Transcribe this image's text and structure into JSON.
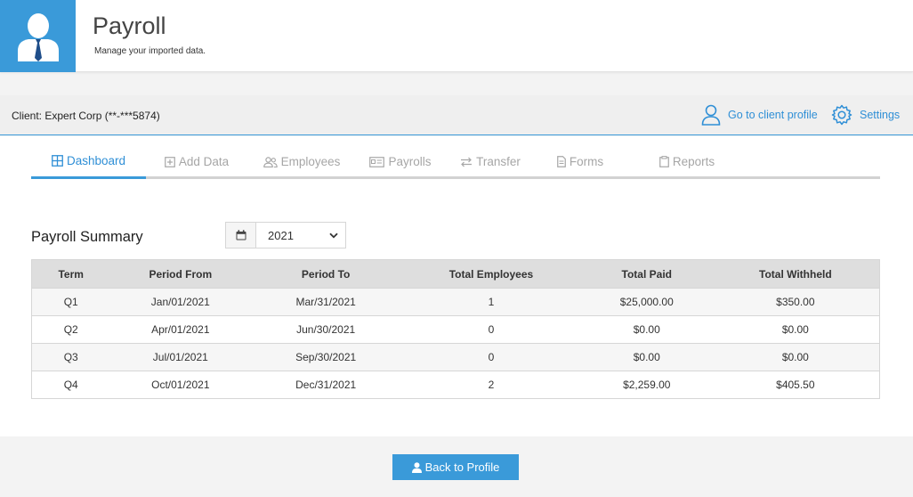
{
  "header": {
    "title": "Payroll",
    "subtitle": "Manage your imported data."
  },
  "client_bar": {
    "client_label": "Client: Expert Corp (**-***5874)",
    "profile_link": "Go to client profile",
    "settings_link": "Settings"
  },
  "tabs": [
    {
      "label": "Dashboard",
      "icon": "grid-icon",
      "active": true
    },
    {
      "label": "Add Data",
      "icon": "plus-square-icon",
      "active": false
    },
    {
      "label": "Employees",
      "icon": "users-icon",
      "active": false
    },
    {
      "label": "Payrolls",
      "icon": "id-card-icon",
      "active": false
    },
    {
      "label": "Transfer",
      "icon": "exchange-icon",
      "active": false
    },
    {
      "label": "Forms",
      "icon": "file-icon",
      "active": false
    },
    {
      "label": "Reports",
      "icon": "clipboard-icon",
      "active": false
    }
  ],
  "summary": {
    "title": "Payroll Summary",
    "year": "2021",
    "columns": [
      "Term",
      "Period From",
      "Period To",
      "Total Employees",
      "Total Paid",
      "Total Withheld"
    ],
    "rows": [
      [
        "Q1",
        "Jan/01/2021",
        "Mar/31/2021",
        "1",
        "$25,000.00",
        "$350.00"
      ],
      [
        "Q2",
        "Apr/01/2021",
        "Jun/30/2021",
        "0",
        "$0.00",
        "$0.00"
      ],
      [
        "Q3",
        "Jul/01/2021",
        "Sep/30/2021",
        "0",
        "$0.00",
        "$0.00"
      ],
      [
        "Q4",
        "Oct/01/2021",
        "Dec/31/2021",
        "2",
        "$2,259.00",
        "$405.50"
      ]
    ]
  },
  "footer": {
    "back_label": "Back to Profile"
  },
  "colors": {
    "accent": "#3a9ad9",
    "link": "#2f8fd6",
    "tab_inactive": "#a6a6a6"
  }
}
